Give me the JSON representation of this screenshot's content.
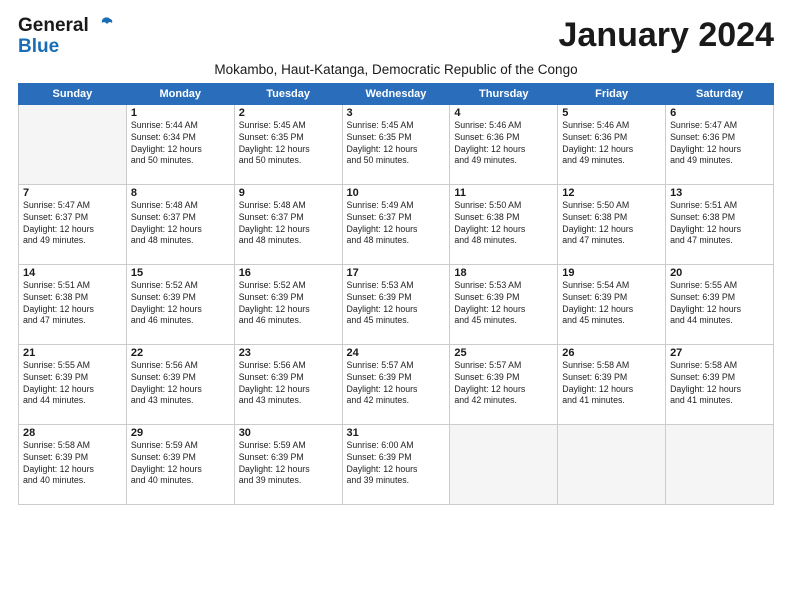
{
  "header": {
    "logo_general": "General",
    "logo_blue": "Blue",
    "month_title": "January 2024",
    "subtitle": "Mokambo, Haut-Katanga, Democratic Republic of the Congo"
  },
  "days_of_week": [
    "Sunday",
    "Monday",
    "Tuesday",
    "Wednesday",
    "Thursday",
    "Friday",
    "Saturday"
  ],
  "weeks": [
    [
      {
        "day": "",
        "info": ""
      },
      {
        "day": "1",
        "info": "Sunrise: 5:44 AM\nSunset: 6:34 PM\nDaylight: 12 hours\nand 50 minutes."
      },
      {
        "day": "2",
        "info": "Sunrise: 5:45 AM\nSunset: 6:35 PM\nDaylight: 12 hours\nand 50 minutes."
      },
      {
        "day": "3",
        "info": "Sunrise: 5:45 AM\nSunset: 6:35 PM\nDaylight: 12 hours\nand 50 minutes."
      },
      {
        "day": "4",
        "info": "Sunrise: 5:46 AM\nSunset: 6:36 PM\nDaylight: 12 hours\nand 49 minutes."
      },
      {
        "day": "5",
        "info": "Sunrise: 5:46 AM\nSunset: 6:36 PM\nDaylight: 12 hours\nand 49 minutes."
      },
      {
        "day": "6",
        "info": "Sunrise: 5:47 AM\nSunset: 6:36 PM\nDaylight: 12 hours\nand 49 minutes."
      }
    ],
    [
      {
        "day": "7",
        "info": "Sunrise: 5:47 AM\nSunset: 6:37 PM\nDaylight: 12 hours\nand 49 minutes."
      },
      {
        "day": "8",
        "info": "Sunrise: 5:48 AM\nSunset: 6:37 PM\nDaylight: 12 hours\nand 48 minutes."
      },
      {
        "day": "9",
        "info": "Sunrise: 5:48 AM\nSunset: 6:37 PM\nDaylight: 12 hours\nand 48 minutes."
      },
      {
        "day": "10",
        "info": "Sunrise: 5:49 AM\nSunset: 6:37 PM\nDaylight: 12 hours\nand 48 minutes."
      },
      {
        "day": "11",
        "info": "Sunrise: 5:50 AM\nSunset: 6:38 PM\nDaylight: 12 hours\nand 48 minutes."
      },
      {
        "day": "12",
        "info": "Sunrise: 5:50 AM\nSunset: 6:38 PM\nDaylight: 12 hours\nand 47 minutes."
      },
      {
        "day": "13",
        "info": "Sunrise: 5:51 AM\nSunset: 6:38 PM\nDaylight: 12 hours\nand 47 minutes."
      }
    ],
    [
      {
        "day": "14",
        "info": "Sunrise: 5:51 AM\nSunset: 6:38 PM\nDaylight: 12 hours\nand 47 minutes."
      },
      {
        "day": "15",
        "info": "Sunrise: 5:52 AM\nSunset: 6:39 PM\nDaylight: 12 hours\nand 46 minutes."
      },
      {
        "day": "16",
        "info": "Sunrise: 5:52 AM\nSunset: 6:39 PM\nDaylight: 12 hours\nand 46 minutes."
      },
      {
        "day": "17",
        "info": "Sunrise: 5:53 AM\nSunset: 6:39 PM\nDaylight: 12 hours\nand 45 minutes."
      },
      {
        "day": "18",
        "info": "Sunrise: 5:53 AM\nSunset: 6:39 PM\nDaylight: 12 hours\nand 45 minutes."
      },
      {
        "day": "19",
        "info": "Sunrise: 5:54 AM\nSunset: 6:39 PM\nDaylight: 12 hours\nand 45 minutes."
      },
      {
        "day": "20",
        "info": "Sunrise: 5:55 AM\nSunset: 6:39 PM\nDaylight: 12 hours\nand 44 minutes."
      }
    ],
    [
      {
        "day": "21",
        "info": "Sunrise: 5:55 AM\nSunset: 6:39 PM\nDaylight: 12 hours\nand 44 minutes."
      },
      {
        "day": "22",
        "info": "Sunrise: 5:56 AM\nSunset: 6:39 PM\nDaylight: 12 hours\nand 43 minutes."
      },
      {
        "day": "23",
        "info": "Sunrise: 5:56 AM\nSunset: 6:39 PM\nDaylight: 12 hours\nand 43 minutes."
      },
      {
        "day": "24",
        "info": "Sunrise: 5:57 AM\nSunset: 6:39 PM\nDaylight: 12 hours\nand 42 minutes."
      },
      {
        "day": "25",
        "info": "Sunrise: 5:57 AM\nSunset: 6:39 PM\nDaylight: 12 hours\nand 42 minutes."
      },
      {
        "day": "26",
        "info": "Sunrise: 5:58 AM\nSunset: 6:39 PM\nDaylight: 12 hours\nand 41 minutes."
      },
      {
        "day": "27",
        "info": "Sunrise: 5:58 AM\nSunset: 6:39 PM\nDaylight: 12 hours\nand 41 minutes."
      }
    ],
    [
      {
        "day": "28",
        "info": "Sunrise: 5:58 AM\nSunset: 6:39 PM\nDaylight: 12 hours\nand 40 minutes."
      },
      {
        "day": "29",
        "info": "Sunrise: 5:59 AM\nSunset: 6:39 PM\nDaylight: 12 hours\nand 40 minutes."
      },
      {
        "day": "30",
        "info": "Sunrise: 5:59 AM\nSunset: 6:39 PM\nDaylight: 12 hours\nand 39 minutes."
      },
      {
        "day": "31",
        "info": "Sunrise: 6:00 AM\nSunset: 6:39 PM\nDaylight: 12 hours\nand 39 minutes."
      },
      {
        "day": "",
        "info": ""
      },
      {
        "day": "",
        "info": ""
      },
      {
        "day": "",
        "info": ""
      }
    ]
  ]
}
